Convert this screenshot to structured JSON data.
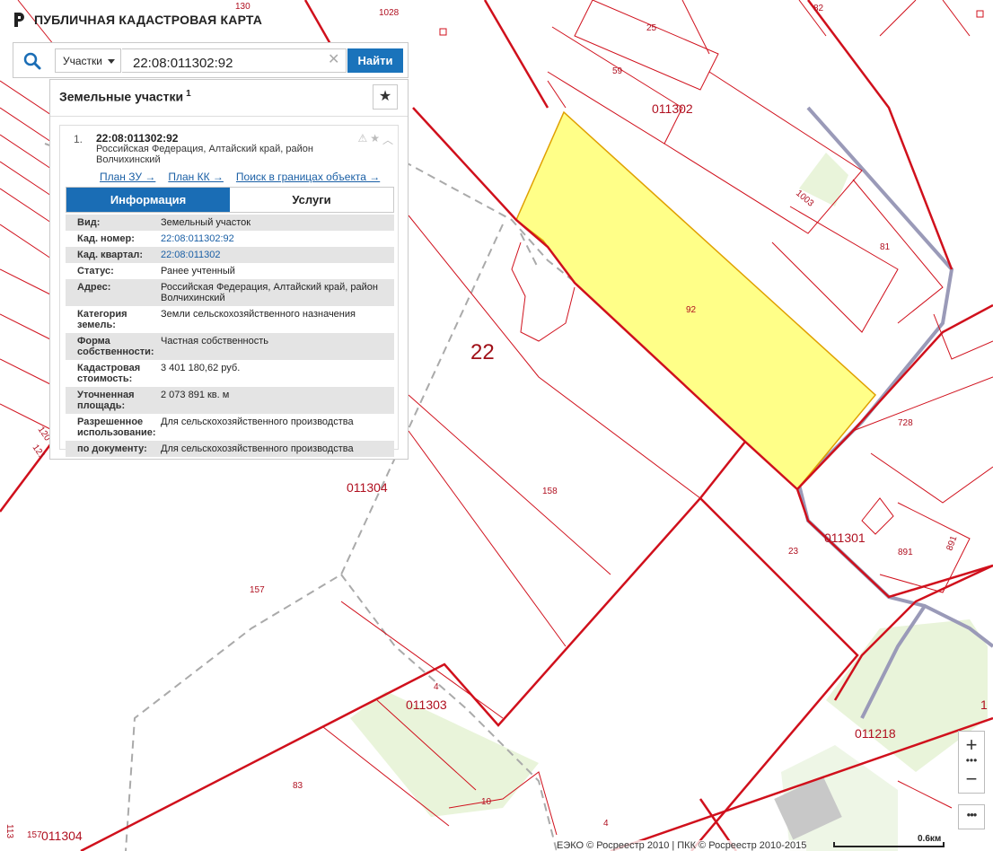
{
  "app": {
    "title": "ПУБЛИЧНАЯ КАДАСТРОВАЯ КАРТА"
  },
  "search": {
    "type_label": "Участки",
    "query": "22:08:011302:92",
    "find_label": "Найти"
  },
  "panel": {
    "title": "Земельные участки",
    "count": "1"
  },
  "result": {
    "index": "1.",
    "number": "22:08:011302:92",
    "address": "Российская Федерация, Алтайский край, район Волчихинский",
    "links": [
      "План ЗУ →",
      "План КК →",
      "Поиск в границах объекта →"
    ]
  },
  "tabs": {
    "info": "Информация",
    "services": "Услуги"
  },
  "info": [
    {
      "key": "Вид:",
      "value": "Земельный участок"
    },
    {
      "key": "Кад. номер:",
      "value": "22:08:011302:92"
    },
    {
      "key": "Кад. квартал:",
      "value": "22:08:011302"
    },
    {
      "key": "Статус:",
      "value": "Ранее учтенный"
    },
    {
      "key": "Адрес:",
      "value": "Российская Федерация, Алтайский край, район Волчихинский"
    },
    {
      "key": "Категория земель:",
      "value": "Земли сельскохозяйственного назначения"
    },
    {
      "key": "Форма собственности:",
      "value": "Частная собственность"
    },
    {
      "key": "Кадастровая стоимость:",
      "value": "3 401 180,62 руб."
    },
    {
      "key": "Уточненная площадь:",
      "value": "2 073 891 кв. м"
    },
    {
      "key": "Разрешенное использование:",
      "value": "Для сельскохозяйственного производства"
    },
    {
      "key": "по документу:",
      "value": "Для сельскохозяйственного производства"
    }
  ],
  "map_labels": {
    "district": "22",
    "q011302": "011302",
    "q011304": "011304",
    "q011304b": "011304",
    "q011303": "011303",
    "q011301": "011301",
    "q011218": "011218",
    "p92": "92",
    "p158": "158",
    "p157": "157",
    "p157b": "157",
    "p81": "81",
    "p728": "728",
    "p23": "23",
    "p891": "891",
    "p891v": "891",
    "p83": "83",
    "p10": "10",
    "p4": "4",
    "p4b": "4",
    "p59": "59",
    "p25": "25",
    "p82": "82",
    "p1028": "1028",
    "p130": "130",
    "p1003": "1003",
    "p120": "120",
    "p121": "121",
    "p1_right": "1",
    "p113": "113"
  },
  "controls": {
    "zoom_in": "+",
    "zoom_out": "−",
    "more": "•••"
  },
  "footer": {
    "attribution": "ЕЭКО © Росреестр 2010 | ПКК © Росреестр 2010-2015",
    "scale": "0.6км"
  },
  "colors": {
    "boundary": "#d0101c",
    "parcel_fill": "#ffff88",
    "accent": "#1a6db5"
  }
}
